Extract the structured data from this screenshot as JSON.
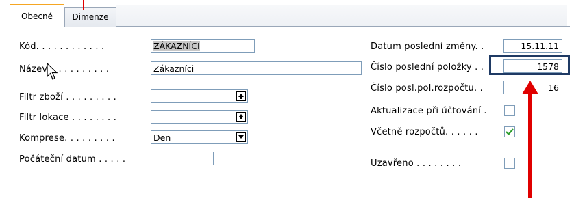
{
  "tabs": [
    {
      "label": "Obecné",
      "active": true
    },
    {
      "label": "Dimenze",
      "active": false
    }
  ],
  "left_fields": [
    {
      "label": "Kód. . . . . . . . . . . .",
      "value": "ZÁKAZNÍCI",
      "selected": true,
      "type": "text"
    },
    {
      "label": "Název. . . . . . . . . . .",
      "value": "Zákazníci",
      "type": "text"
    },
    {
      "label": "Filtr zboží . . . . . . . . .",
      "value": "",
      "type": "lookup"
    },
    {
      "label": "Filtr lokace . . . . . . . .",
      "value": "",
      "type": "lookup"
    },
    {
      "label": "Komprese. . . . . . . . .",
      "value": "Den",
      "type": "dropdown"
    },
    {
      "label": "Počáteční datum . . . . .",
      "value": "",
      "type": "text"
    }
  ],
  "right_fields": [
    {
      "label": "Datum poslední změny. .",
      "value": "15.11.11"
    },
    {
      "label": "Číslo poslední položky . .",
      "value": "1578"
    },
    {
      "label": "Číslo posl.pol.rozpočtu. .",
      "value": "16"
    }
  ],
  "checkboxes": [
    {
      "label": "Aktualizace při účtování .",
      "checked": false
    },
    {
      "label": "Včetně rozpočtů. . . . . .",
      "checked": true
    },
    {
      "label": "Uzavřeno . . . . . . . .",
      "checked": false
    }
  ],
  "colors": {
    "tab_accent": "#f5a623",
    "highlight_box": "#1f3a64",
    "annotation_red": "#e00000",
    "check_green": "#2e9e2e"
  },
  "icons": {
    "lookup": "lookup-arrow-icon",
    "dropdown": "dropdown-arrow-icon",
    "cursor": "mouse-pointer-icon"
  }
}
